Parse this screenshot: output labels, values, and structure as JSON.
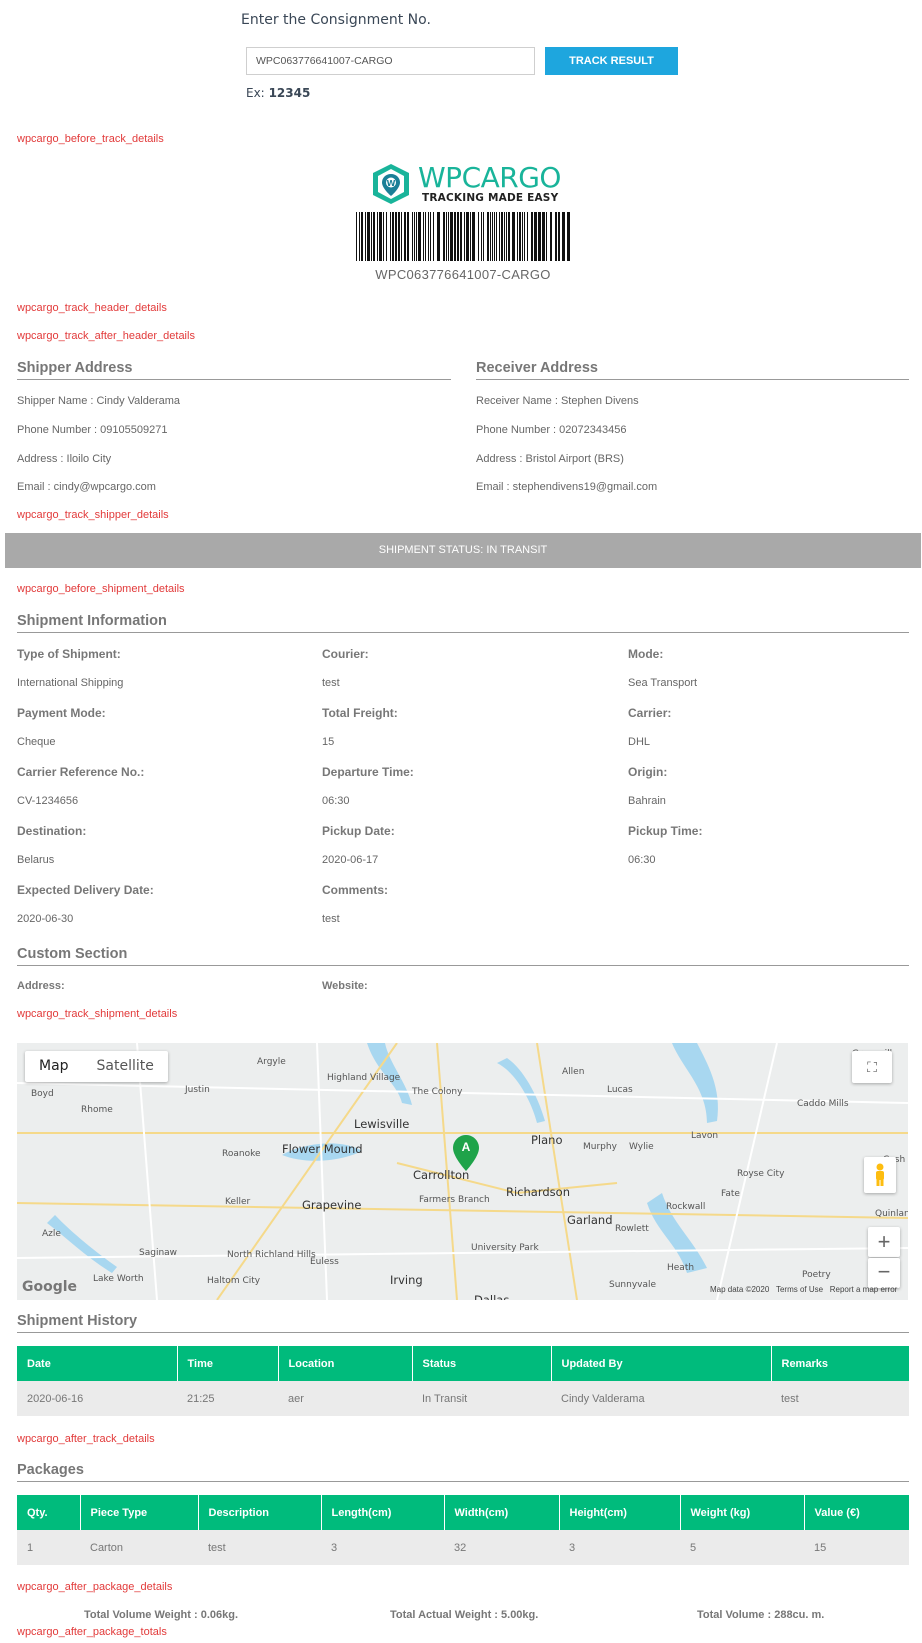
{
  "tracking": {
    "title": "Enter the Consignment No.",
    "input_value": "WPC063776641007-CARGO",
    "button_label": "TRACK RESULT",
    "example_prefix": "Ex:",
    "example_value": "12345"
  },
  "hooks": {
    "before_track_details": "wpcargo_before_track_details",
    "track_header_details": "wpcargo_track_header_details",
    "track_after_header_details": "wpcargo_track_after_header_details",
    "track_shipper_details": "wpcargo_track_shipper_details",
    "before_shipment_details": "wpcargo_before_shipment_details",
    "track_shipment_details": "wpcargo_track_shipment_details",
    "after_track_details": "wpcargo_after_track_details",
    "after_package_details": "wpcargo_after_package_details",
    "after_package_totals": "wpcargo_after_package_totals"
  },
  "logo": {
    "text": "WPCARGO",
    "tagline": "TRACKING MADE EASY",
    "brand_color": "#19b49a"
  },
  "barcode_text": "WPC063776641007-CARGO",
  "shipper": {
    "title": "Shipper Address",
    "name": "Shipper Name : Cindy Valderama",
    "phone": "Phone Number : 09105509271",
    "address": "Address : Iloilo City",
    "email": "Email : cindy@wpcargo.com"
  },
  "receiver": {
    "title": "Receiver Address",
    "name": "Receiver Name : Stephen Divens",
    "phone": "Phone Number : 02072343456",
    "address": "Address : Bristol Airport (BRS)",
    "email": "Email : stephendivens19@gmail.com"
  },
  "status_bar": "SHIPMENT STATUS: IN TRANSIT",
  "shipment_info": {
    "title": "Shipment Information",
    "fields": [
      {
        "label": "Type of Shipment:",
        "value": "International Shipping"
      },
      {
        "label": "Courier:",
        "value": "test"
      },
      {
        "label": "Mode:",
        "value": "Sea Transport"
      },
      {
        "label": "Payment Mode:",
        "value": "Cheque"
      },
      {
        "label": "Total Freight:",
        "value": "15"
      },
      {
        "label": "Carrier:",
        "value": "DHL"
      },
      {
        "label": "Carrier Reference No.:",
        "value": "CV-1234656"
      },
      {
        "label": "Departure Time:",
        "value": "06:30"
      },
      {
        "label": "Origin:",
        "value": "Bahrain"
      },
      {
        "label": "Destination:",
        "value": "Belarus"
      },
      {
        "label": "Pickup Date:",
        "value": "2020-06-17"
      },
      {
        "label": "Pickup Time:",
        "value": "06:30"
      },
      {
        "label": "Expected Delivery Date:",
        "value": "2020-06-30"
      },
      {
        "label": "Comments:",
        "value": "test"
      }
    ]
  },
  "custom_section": {
    "title": "Custom Section",
    "address_label": "Address:",
    "website_label": "Website:"
  },
  "map": {
    "tab_map": "Map",
    "tab_satellite": "Satellite",
    "marker_label": "A",
    "google": "Google",
    "attribution_data": "Map data ©2020",
    "attribution_terms": "Terms of Use",
    "attribution_report": "Report a map error",
    "zoom_in": "+",
    "zoom_out": "−",
    "places": [
      "Greenvill",
      "Argyle",
      "Highland Village",
      "Allen",
      "Justin",
      "Lucas",
      "Boyd",
      "Rhome",
      "The Colony",
      "Caddo Mills",
      "Lewisville",
      "Plano",
      "Lavon",
      "Roanoke",
      "Flower Mound",
      "Murphy",
      "Wylie",
      "Carrollton",
      "Richardson",
      "Royse City",
      "Keller",
      "Grapevine",
      "Farmers Branch",
      "Garland",
      "Rockwall",
      "Fate",
      "Cash",
      "Quinlan",
      "Azle",
      "Rowlett",
      "Saginaw",
      "North Richland Hills",
      "Euless",
      "University Park",
      "Heath",
      "Poetry",
      "Lake Worth",
      "Haltom City",
      "Irving",
      "Sunnyvale",
      "Dallas"
    ]
  },
  "history": {
    "title": "Shipment History",
    "headers": [
      "Date",
      "Time",
      "Location",
      "Status",
      "Updated By",
      "Remarks"
    ],
    "rows": [
      [
        "2020-06-16",
        "21:25",
        "aer",
        "In Transit",
        "Cindy Valderama",
        "test"
      ]
    ]
  },
  "packages": {
    "title": "Packages",
    "headers": [
      "Qty.",
      "Piece Type",
      "Description",
      "Length(cm)",
      "Width(cm)",
      "Height(cm)",
      "Weight (kg)",
      "Value (€)"
    ],
    "rows": [
      [
        "1",
        "Carton",
        "test",
        "3",
        "32",
        "3",
        "5",
        "15"
      ]
    ]
  },
  "totals": {
    "volume_weight": "Total Volume Weight : 0.06kg.",
    "actual_weight": "Total Actual Weight : 5.00kg.",
    "volume": "Total Volume : 288cu. m."
  },
  "colors": {
    "accent_button": "#1ea6de",
    "table_header": "#00bb7c",
    "hook_text": "#e23a3a",
    "status_bar": "#a9a9a9"
  }
}
